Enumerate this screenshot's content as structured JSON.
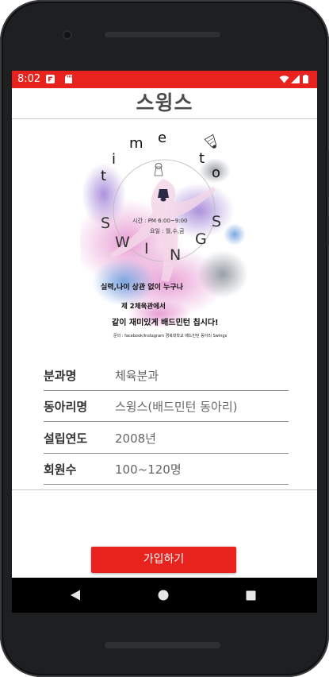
{
  "status_bar": {
    "time": "8:02",
    "color": "#e8231e",
    "icons": [
      "app-notification-icon",
      "sd-card-icon",
      "wifi-icon",
      "signal-icon",
      "battery-icon"
    ]
  },
  "app_bar": {
    "title": "스윙스"
  },
  "poster": {
    "title_letters_time": [
      "t",
      "i",
      "m",
      "e",
      "t",
      "o"
    ],
    "title_letters_swings": [
      "S",
      "W",
      "I",
      "N",
      "G",
      "S"
    ],
    "schedule_time": "시간 : PM 6:00~9:00",
    "schedule_days": "요일 : 월,수,금",
    "slogan_1": "실력,나이 상관 없이 누구나",
    "slogan_2": "제 2체육관에서",
    "slogan_3": "같이 재미있게 배드민턴 칩시다!",
    "contact": "문의 : facebook/Instagram 경북대학교 배드민턴 동아리 Swings",
    "colors": {
      "pink": "#e79ad2",
      "blue": "#6c9fe0",
      "purple": "#9d7fd6",
      "gray": "#7f8790"
    }
  },
  "info": {
    "rows": [
      {
        "label": "분과명",
        "value": "체육분과"
      },
      {
        "label": "동아리명",
        "value": "스윙스(배드민턴 동아리)"
      },
      {
        "label": "설립연도",
        "value": "2008년"
      },
      {
        "label": "회원수",
        "value": "100~120명"
      }
    ]
  },
  "join_button": {
    "label": "가입하기",
    "color": "#e8231e"
  },
  "nav_bar": {
    "icons": [
      "back-triangle-icon",
      "home-circle-icon",
      "recents-square-icon"
    ]
  }
}
